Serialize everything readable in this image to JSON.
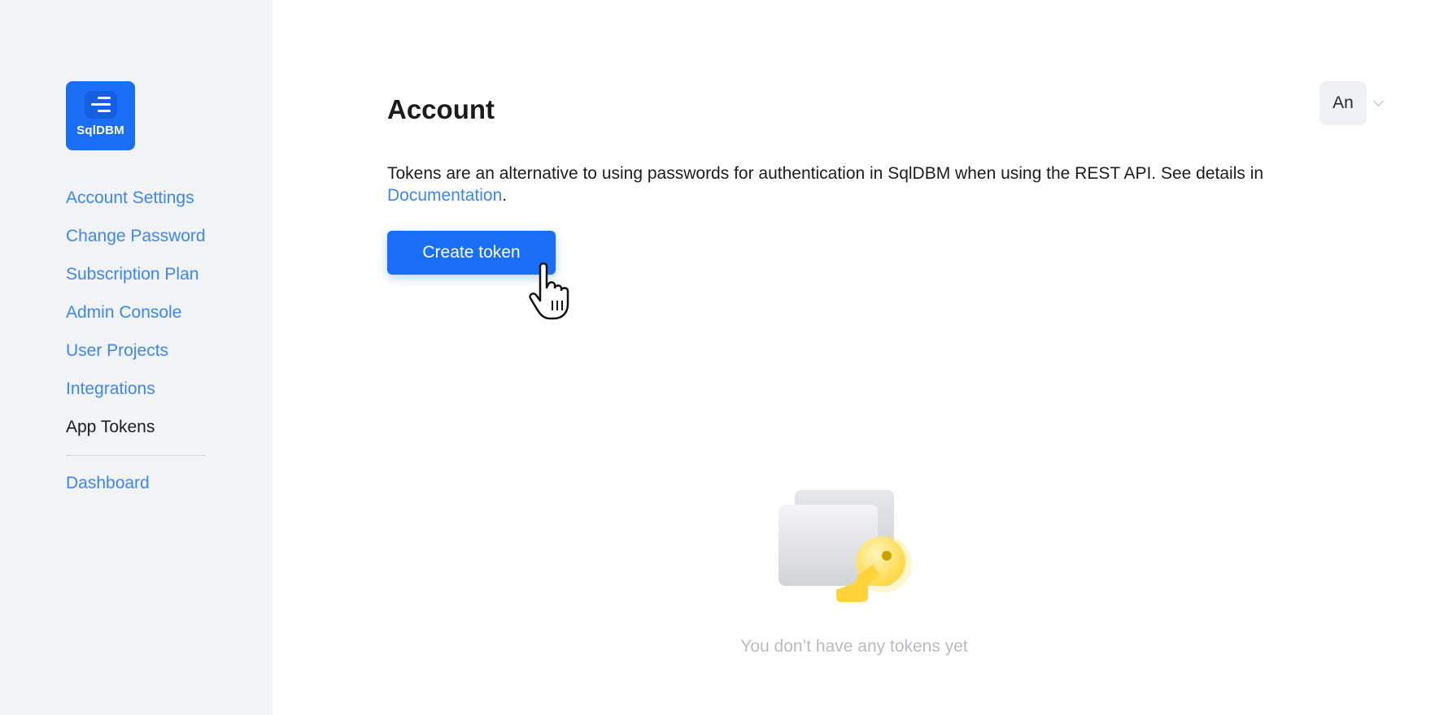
{
  "brand": {
    "name": "SqlDBM",
    "accent": "#1a6ef5"
  },
  "sidebar": {
    "items": [
      {
        "label": "Account Settings"
      },
      {
        "label": "Change Password"
      },
      {
        "label": "Subscription Plan"
      },
      {
        "label": "Admin Console"
      },
      {
        "label": "User Projects"
      },
      {
        "label": "Integrations"
      },
      {
        "label": "App Tokens",
        "active": true
      }
    ],
    "dashboard_label": "Dashboard"
  },
  "header": {
    "title": "Account",
    "user_initials": "An"
  },
  "main": {
    "description": "Tokens are an alternative to using passwords for authentication in SqlDBM when using the REST API. See details in",
    "doc_link": "Documentation",
    "doc_suffix": ".",
    "create_button": "Create token",
    "empty_state": "You don’t have any tokens yet"
  },
  "icons": {
    "logo": "sqldbm-logo-icon",
    "cursor": "hand-pointer-icon",
    "empty": "key-cards-icon",
    "chevron": "chevron-down-icon"
  }
}
